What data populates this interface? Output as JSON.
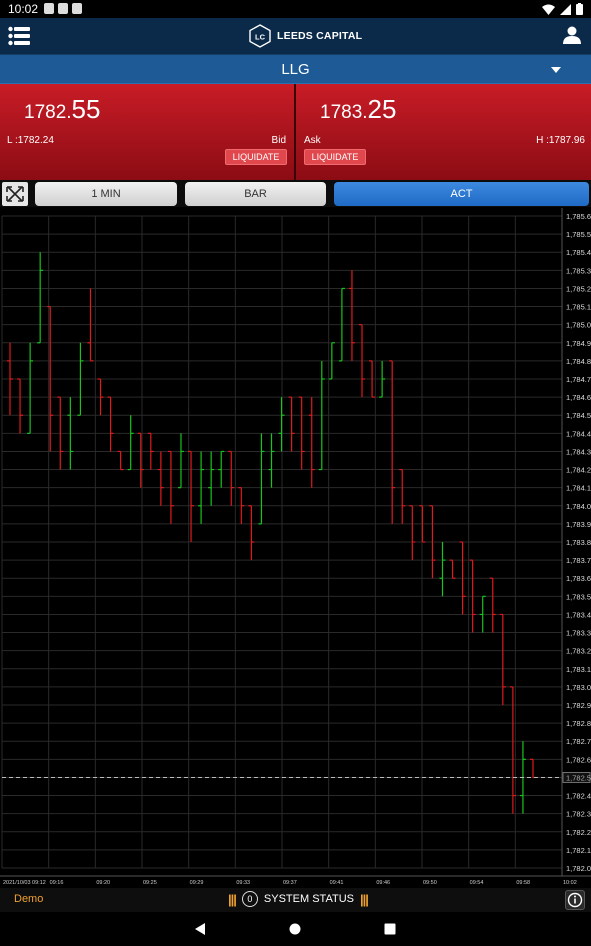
{
  "status_bar": {
    "time": "10:02"
  },
  "app": {
    "brand_initials": "LC",
    "brand_name": "LEEDS CAPITAL"
  },
  "symbol": "LLG",
  "bid": {
    "price_small": "1782.",
    "price_big": "55",
    "low_label": "L :1782.24",
    "side_label": "Bid",
    "liquidate_label": "LIQUIDATE"
  },
  "ask": {
    "price_small": "1783.",
    "price_big": "25",
    "high_label": "H :1787.96",
    "side_label": "Ask",
    "liquidate_label": "LIQUIDATE"
  },
  "toolbar": {
    "interval_label": "1 MIN",
    "chart_type_label": "BAR",
    "mode_label": "ACT"
  },
  "colors": {
    "up": "#19c41c",
    "down": "#e01b1b",
    "accent": "#2a7fd6",
    "bid_bg": "#b3141d",
    "grid": "#2a2a2a"
  },
  "chart_data": {
    "type": "bar",
    "ylim": [
      1782.0,
      1785.6
    ],
    "y_ticks": [
      "1,785.6",
      "1,785.5",
      "1,785.4",
      "1,785.3",
      "1,785.2",
      "1,785.1",
      "1,785.0",
      "1,784.9",
      "1,784.8",
      "1,784.7",
      "1,784.6",
      "1,784.5",
      "1,784.4",
      "1,784.3",
      "1,784.2",
      "1,784.1",
      "1,784.0",
      "1,783.9",
      "1,783.8",
      "1,783.7",
      "1,783.6",
      "1,783.5",
      "1,783.4",
      "1,783.3",
      "1,783.2",
      "1,783.1",
      "1,783.0",
      "1,782.9",
      "1,782.8",
      "1,782.7",
      "1,782.6",
      "1,782.5",
      "1,782.4",
      "1,782.3",
      "1,782.2",
      "1,782.1",
      "1,782.0"
    ],
    "x_ticks": [
      "2021/10/03 09:12",
      "09:16",
      "09:20",
      "09:25",
      "09:29",
      "09:33",
      "09:37",
      "09:41",
      "09:46",
      "09:50",
      "09:54",
      "09:58",
      "10:02"
    ],
    "current_price": 1782.5,
    "current_price_label": "1,782.5",
    "bars": [
      {
        "o": 1784.8,
        "h": 1784.9,
        "l": 1784.5,
        "c": 1784.7,
        "up": false
      },
      {
        "o": 1784.7,
        "h": 1784.7,
        "l": 1784.4,
        "c": 1784.5,
        "up": false
      },
      {
        "o": 1784.4,
        "h": 1784.9,
        "l": 1784.4,
        "c": 1784.8,
        "up": true
      },
      {
        "o": 1784.9,
        "h": 1785.4,
        "l": 1784.9,
        "c": 1785.3,
        "up": true
      },
      {
        "o": 1785.1,
        "h": 1785.1,
        "l": 1784.3,
        "c": 1784.5,
        "up": false
      },
      {
        "o": 1784.6,
        "h": 1784.6,
        "l": 1784.2,
        "c": 1784.3,
        "up": false
      },
      {
        "o": 1784.5,
        "h": 1784.6,
        "l": 1784.2,
        "c": 1784.3,
        "up": true
      },
      {
        "o": 1784.5,
        "h": 1784.9,
        "l": 1784.5,
        "c": 1784.8,
        "up": true
      },
      {
        "o": 1784.9,
        "h": 1785.2,
        "l": 1784.8,
        "c": 1784.8,
        "up": false
      },
      {
        "o": 1784.7,
        "h": 1784.7,
        "l": 1784.5,
        "c": 1784.6,
        "up": false
      },
      {
        "o": 1784.6,
        "h": 1784.6,
        "l": 1784.3,
        "c": 1784.4,
        "up": false
      },
      {
        "o": 1784.3,
        "h": 1784.3,
        "l": 1784.2,
        "c": 1784.2,
        "up": false
      },
      {
        "o": 1784.2,
        "h": 1784.5,
        "l": 1784.2,
        "c": 1784.4,
        "up": true
      },
      {
        "o": 1784.4,
        "h": 1784.4,
        "l": 1784.1,
        "c": 1784.2,
        "up": false
      },
      {
        "o": 1784.4,
        "h": 1784.4,
        "l": 1784.2,
        "c": 1784.3,
        "up": false
      },
      {
        "o": 1784.2,
        "h": 1784.3,
        "l": 1784.0,
        "c": 1784.1,
        "up": false
      },
      {
        "o": 1784.3,
        "h": 1784.3,
        "l": 1783.9,
        "c": 1784.0,
        "up": false
      },
      {
        "o": 1784.1,
        "h": 1784.4,
        "l": 1784.1,
        "c": 1784.3,
        "up": true
      },
      {
        "o": 1784.3,
        "h": 1784.3,
        "l": 1783.8,
        "c": 1784.0,
        "up": false
      },
      {
        "o": 1784.0,
        "h": 1784.3,
        "l": 1783.9,
        "c": 1784.2,
        "up": true
      },
      {
        "o": 1784.1,
        "h": 1784.3,
        "l": 1784.0,
        "c": 1784.2,
        "up": true
      },
      {
        "o": 1784.2,
        "h": 1784.3,
        "l": 1784.1,
        "c": 1784.3,
        "up": true
      },
      {
        "o": 1784.3,
        "h": 1784.3,
        "l": 1784.0,
        "c": 1784.1,
        "up": false
      },
      {
        "o": 1784.1,
        "h": 1784.1,
        "l": 1783.9,
        "c": 1784.0,
        "up": false
      },
      {
        "o": 1784.0,
        "h": 1784.0,
        "l": 1783.7,
        "c": 1783.8,
        "up": false
      },
      {
        "o": 1783.9,
        "h": 1784.4,
        "l": 1783.9,
        "c": 1784.3,
        "up": true
      },
      {
        "o": 1784.2,
        "h": 1784.4,
        "l": 1784.1,
        "c": 1784.3,
        "up": true
      },
      {
        "o": 1784.4,
        "h": 1784.6,
        "l": 1784.3,
        "c": 1784.5,
        "up": true
      },
      {
        "o": 1784.6,
        "h": 1784.6,
        "l": 1784.3,
        "c": 1784.4,
        "up": false
      },
      {
        "o": 1784.6,
        "h": 1784.6,
        "l": 1784.2,
        "c": 1784.3,
        "up": false
      },
      {
        "o": 1784.5,
        "h": 1784.6,
        "l": 1784.1,
        "c": 1784.2,
        "up": false
      },
      {
        "o": 1784.2,
        "h": 1784.8,
        "l": 1784.2,
        "c": 1784.7,
        "up": true
      },
      {
        "o": 1784.7,
        "h": 1784.9,
        "l": 1784.7,
        "c": 1784.9,
        "up": true
      },
      {
        "o": 1784.8,
        "h": 1785.2,
        "l": 1784.8,
        "c": 1785.2,
        "up": true
      },
      {
        "o": 1785.2,
        "h": 1785.3,
        "l": 1784.8,
        "c": 1784.9,
        "up": false
      },
      {
        "o": 1785.0,
        "h": 1785.0,
        "l": 1784.6,
        "c": 1784.7,
        "up": false
      },
      {
        "o": 1784.8,
        "h": 1784.8,
        "l": 1784.6,
        "c": 1784.6,
        "up": false
      },
      {
        "o": 1784.6,
        "h": 1784.8,
        "l": 1784.6,
        "c": 1784.7,
        "up": true
      },
      {
        "o": 1784.8,
        "h": 1784.8,
        "l": 1783.9,
        "c": 1784.1,
        "up": false
      },
      {
        "o": 1784.2,
        "h": 1784.2,
        "l": 1783.9,
        "c": 1784.0,
        "up": false
      },
      {
        "o": 1784.0,
        "h": 1784.0,
        "l": 1783.7,
        "c": 1783.8,
        "up": false
      },
      {
        "o": 1784.0,
        "h": 1784.0,
        "l": 1783.8,
        "c": 1783.8,
        "up": false
      },
      {
        "o": 1784.0,
        "h": 1784.0,
        "l": 1783.6,
        "c": 1783.7,
        "up": false
      },
      {
        "o": 1783.6,
        "h": 1783.8,
        "l": 1783.5,
        "c": 1783.7,
        "up": true
      },
      {
        "o": 1783.7,
        "h": 1783.7,
        "l": 1783.6,
        "c": 1783.6,
        "up": false
      },
      {
        "o": 1783.8,
        "h": 1783.8,
        "l": 1783.4,
        "c": 1783.5,
        "up": false
      },
      {
        "o": 1783.7,
        "h": 1783.7,
        "l": 1783.3,
        "c": 1783.4,
        "up": false
      },
      {
        "o": 1783.4,
        "h": 1783.5,
        "l": 1783.3,
        "c": 1783.5,
        "up": true
      },
      {
        "o": 1783.6,
        "h": 1783.6,
        "l": 1783.3,
        "c": 1783.4,
        "up": false
      },
      {
        "o": 1783.4,
        "h": 1783.4,
        "l": 1782.9,
        "c": 1783.0,
        "up": false
      },
      {
        "o": 1783.0,
        "h": 1783.0,
        "l": 1782.3,
        "c": 1782.4,
        "up": false
      },
      {
        "o": 1782.4,
        "h": 1782.7,
        "l": 1782.3,
        "c": 1782.6,
        "up": true
      },
      {
        "o": 1782.6,
        "h": 1782.6,
        "l": 1782.5,
        "c": 1782.5,
        "up": false
      }
    ]
  },
  "footer": {
    "demo_label": "Demo",
    "status_count": "0",
    "status_label": "SYSTEM STATUS"
  }
}
